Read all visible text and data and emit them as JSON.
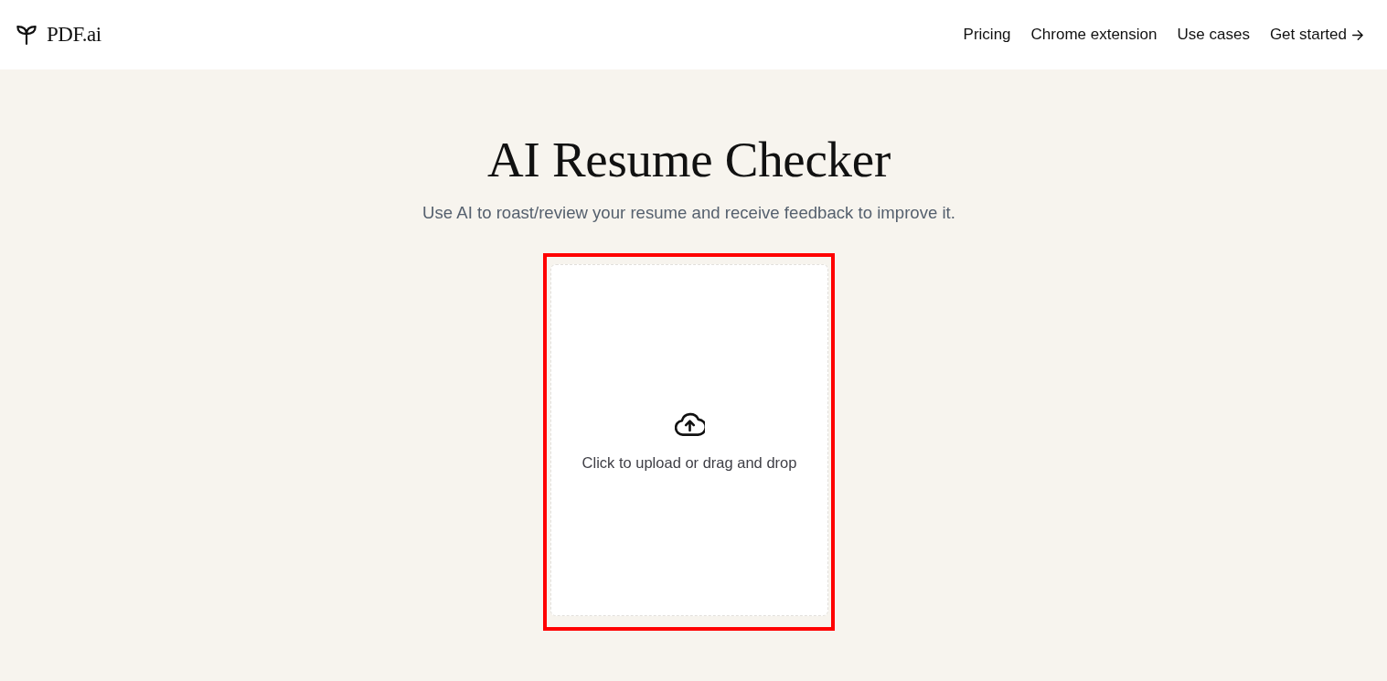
{
  "header": {
    "logo": {
      "text": "PDF.ai"
    },
    "nav": [
      {
        "label": "Pricing",
        "kind": "link"
      },
      {
        "label": "Chrome extension",
        "kind": "link"
      },
      {
        "label": "Use cases",
        "kind": "link"
      },
      {
        "label": "Get started",
        "kind": "cta"
      }
    ]
  },
  "hero": {
    "title": "AI Resume Checker",
    "subtitle": "Use AI to roast/review your resume and receive feedback to improve it."
  },
  "upload": {
    "prompt": "Click to upload or drag and drop",
    "highlighted": true
  }
}
